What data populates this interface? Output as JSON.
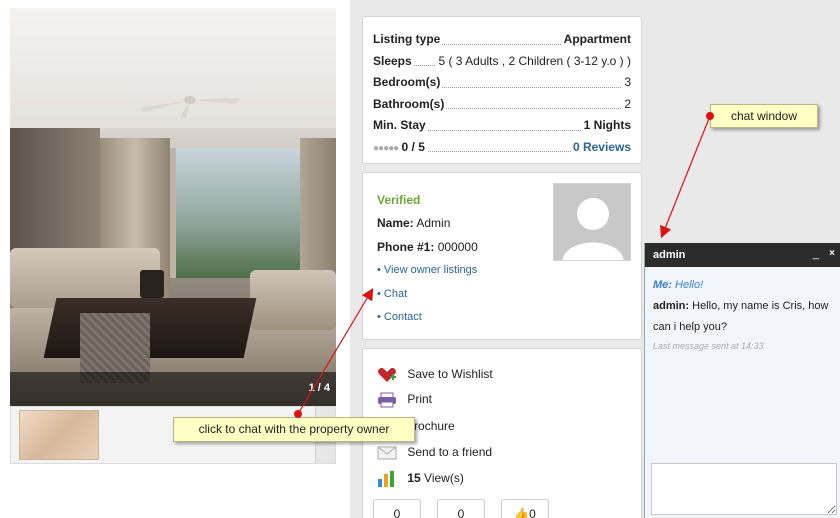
{
  "gallery": {
    "counter": "1 / 4"
  },
  "listing": {
    "rows": [
      {
        "label": "Listing type",
        "value": "Appartment"
      },
      {
        "label": "Sleeps",
        "value": "5 ( 3 Adults , 2 Children ( 3-12 y.o ) )"
      },
      {
        "label": "Bedroom(s)",
        "value": "3"
      },
      {
        "label": "Bathroom(s)",
        "value": "2"
      },
      {
        "label": "Min. Stay",
        "value": "1 Nights"
      }
    ],
    "rating": {
      "circles": "●●●●●",
      "score": "0 / 5",
      "reviews": "0 Reviews"
    }
  },
  "owner": {
    "verified": "Verified",
    "name_label": "Name:",
    "name_value": "Admin",
    "phone_label": "Phone #1:",
    "phone_value": "000000",
    "links": {
      "listings": "• View owner listings",
      "chat": "• Chat",
      "contact": "• Contact"
    }
  },
  "actions": {
    "wishlist": "Save to Wishlist",
    "print": "Print",
    "brochure": "brochure",
    "friend": "Send to a friend",
    "views_count": "15",
    "views_label": "View(s)",
    "votes": [
      "0",
      "0",
      "0"
    ]
  },
  "chat": {
    "title": "admin",
    "minimize": "_",
    "close": "×",
    "me_label": "Me:",
    "me_text": "Hello!",
    "admin_label": "admin:",
    "admin_text": "Hello, my name is Cris, how can i help you?",
    "last_sent": "Last message sent at 14:33",
    "input_value": ""
  },
  "callouts": {
    "chat_window": "chat window",
    "chat_link": "click to chat with the property owner"
  },
  "colors": {
    "verified": "#6fa33a",
    "link": "#2a6496",
    "callout_bg": "#ffffc4",
    "arrow": "#dd1111",
    "chat_header": "#2c2c2c"
  }
}
